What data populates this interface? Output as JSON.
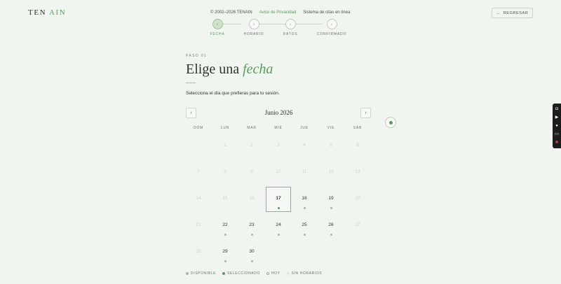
{
  "brand": {
    "name_a": "TEN",
    "name_b": "AIN"
  },
  "header": {
    "copyright": "© 2002–2026 TENAIN",
    "privacy_link": "Aviso de Privacidad",
    "system_name": "Sistema de citas en línea",
    "back_label": "REGRESAR"
  },
  "stepper": {
    "steps": [
      {
        "num": "1",
        "label": "FECHA",
        "active": true
      },
      {
        "num": "2",
        "label": "HORARIO",
        "active": false
      },
      {
        "num": "3",
        "label": "DATOS",
        "active": false
      },
      {
        "num": "4",
        "label": "CONFIRMADO",
        "active": false
      }
    ]
  },
  "main": {
    "step_label": "PASO 01",
    "title_plain": "Elige una",
    "title_accent": "fecha",
    "subtitle": "Selecciona el día que prefieras para tu sesión."
  },
  "calendar": {
    "month_label": "Junio 2026",
    "weekdays": [
      "DOM",
      "LUN",
      "MAR",
      "MIÉ",
      "JUE",
      "VIE",
      "SÁB"
    ],
    "weeks": [
      [
        null,
        {
          "d": "1",
          "s": "u"
        },
        {
          "d": "2",
          "s": "u"
        },
        {
          "d": "3",
          "s": "u"
        },
        {
          "d": "4",
          "s": "u"
        },
        {
          "d": "5",
          "s": "u"
        },
        {
          "d": "6",
          "s": "u"
        }
      ],
      [
        {
          "d": "7",
          "s": "u"
        },
        {
          "d": "8",
          "s": "u"
        },
        {
          "d": "9",
          "s": "u"
        },
        {
          "d": "10",
          "s": "u"
        },
        {
          "d": "11",
          "s": "u"
        },
        {
          "d": "12",
          "s": "u"
        },
        {
          "d": "13",
          "s": "u"
        }
      ],
      [
        {
          "d": "14",
          "s": "u"
        },
        {
          "d": "15",
          "s": "u"
        },
        {
          "d": "16",
          "s": "u"
        },
        {
          "d": "17",
          "s": "sel"
        },
        {
          "d": "18",
          "s": "a"
        },
        {
          "d": "19",
          "s": "a"
        },
        {
          "d": "20",
          "s": "u"
        }
      ],
      [
        {
          "d": "21",
          "s": "u"
        },
        {
          "d": "22",
          "s": "a"
        },
        {
          "d": "23",
          "s": "a"
        },
        {
          "d": "24",
          "s": "a"
        },
        {
          "d": "25",
          "s": "a"
        },
        {
          "d": "26",
          "s": "a"
        },
        {
          "d": "27",
          "s": "u"
        }
      ],
      [
        {
          "d": "28",
          "s": "u"
        },
        {
          "d": "29",
          "s": "a"
        },
        {
          "d": "30",
          "s": "a"
        },
        null,
        null,
        null,
        null
      ]
    ]
  },
  "legend": [
    {
      "label": "DISPONIBLE",
      "color": "#9bc097"
    },
    {
      "label": "SELECCIONADO",
      "color": "#5a9a60"
    },
    {
      "label": "HOY",
      "color": "#f7faf6"
    },
    {
      "label": "SIN HORARIOS",
      "color": "#dfe6dd"
    }
  ],
  "colors": {
    "accent": "#5a9a60",
    "background": "#f1f5ef",
    "text": "#2e332e"
  },
  "icons": {
    "back": "arrow-left-icon",
    "prev": "chevron-left-icon",
    "next": "chevron-right-icon",
    "toolbar": [
      "camera-icon",
      "video-icon",
      "user-icon",
      "window-icon",
      "settings-icon"
    ]
  }
}
